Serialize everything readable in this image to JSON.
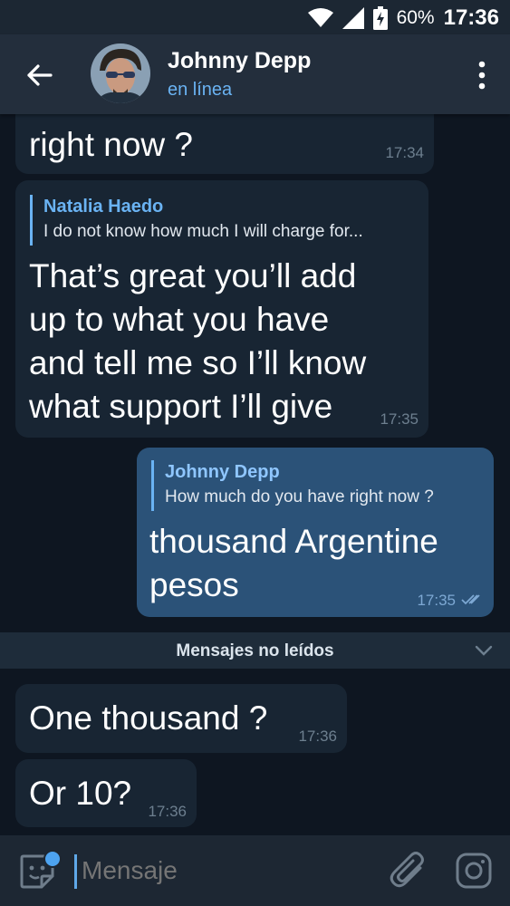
{
  "status_bar": {
    "battery": "60%",
    "time": "17:36"
  },
  "header": {
    "title": "Johnny Depp",
    "subtitle": "en línea"
  },
  "messages": [
    {
      "lines": [
        "right now ?"
      ],
      "time": "17:34"
    },
    {
      "reply_name": "Natalia Haedo",
      "reply_text": "I do not know how much I will charge for...",
      "lines": [
        "That’s great you’ll add",
        "up to what you have",
        "and tell me so I’ll know",
        "what support I’ll give"
      ],
      "time": "17:35"
    },
    {
      "reply_name": "Johnny Depp",
      "reply_text": "How much do you have right now ?",
      "lines": [
        "thousand Argentine",
        "pesos"
      ],
      "time": "17:35"
    },
    {
      "lines": [
        "One thousand ?"
      ],
      "time": "17:36"
    },
    {
      "lines": [
        "Or 10?"
      ],
      "time": "17:36"
    }
  ],
  "unread_label": "Mensajes no leídos",
  "input": {
    "placeholder": "Mensaje"
  },
  "colors": {
    "background": "#0e1621",
    "incoming": "#182533",
    "outgoing": "#2b5278",
    "accent": "#6ab3f3"
  },
  "icons": [
    "wifi-icon",
    "signal-icon",
    "battery-charging-icon",
    "back-arrow-icon",
    "more-vert-icon",
    "double-check-icon",
    "chevron-down-icon",
    "sticker-emoji-icon",
    "attach-paperclip-icon",
    "instagram-camera-icon"
  ]
}
